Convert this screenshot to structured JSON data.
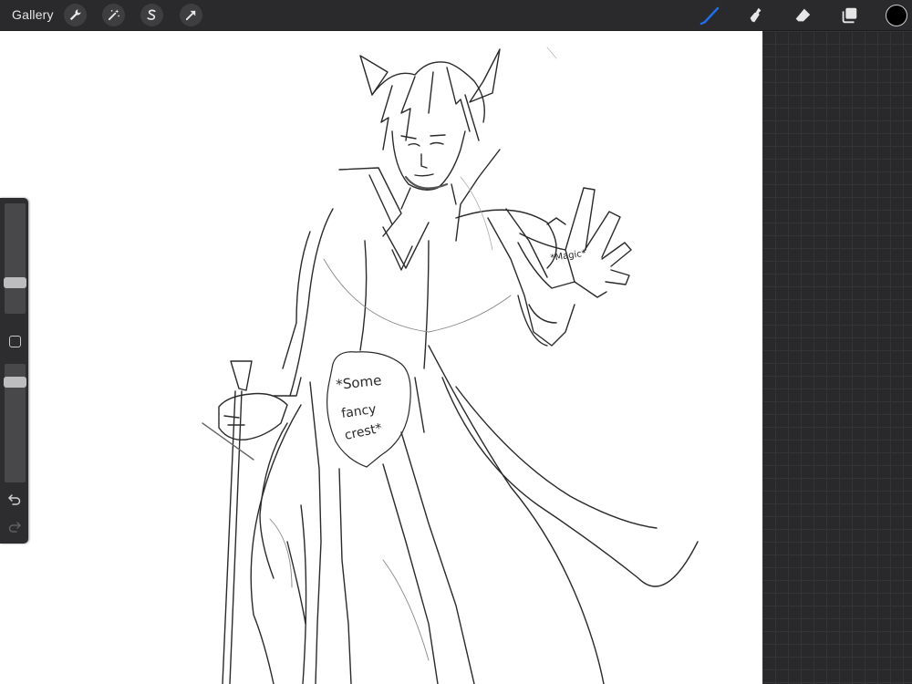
{
  "toolbar": {
    "gallery_label": "Gallery",
    "left_tools": [
      "wrench-icon",
      "magic-wand-icon",
      "selection-s-icon",
      "transform-arrow-icon"
    ],
    "right_tools": [
      "brush-icon",
      "smudge-icon",
      "eraser-icon",
      "layers-icon"
    ],
    "active_tool": "brush-icon",
    "accent_color": "#1e6ff0",
    "current_color": "#000000"
  },
  "sidebar": {
    "brush_size_level": 0.26,
    "opacity_level": 0.88,
    "undo_icon": "undo-icon",
    "redo_icon": "redo-icon"
  },
  "canvas": {
    "background": "#ffffff",
    "annotations": {
      "magic_label": "*Magic*",
      "crest_line1": "*Some",
      "crest_line2": "fancy",
      "crest_line3": "crest*"
    }
  }
}
